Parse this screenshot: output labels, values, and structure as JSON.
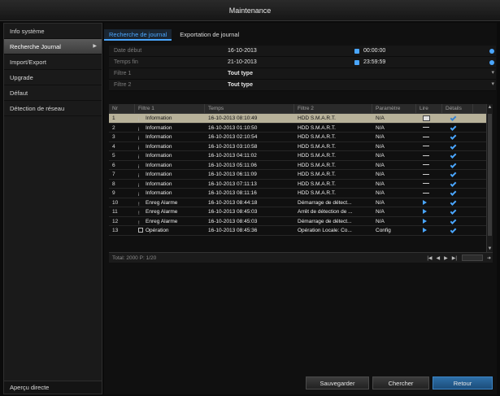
{
  "window": {
    "title": "Maintenance"
  },
  "sidebar": {
    "items": [
      {
        "label": "Info système",
        "active": false
      },
      {
        "label": "Recherche Journal",
        "active": true
      },
      {
        "label": "Import/Export",
        "active": false
      },
      {
        "label": "Upgrade",
        "active": false
      },
      {
        "label": "Défaut",
        "active": false
      },
      {
        "label": "Détection de réseau",
        "active": false
      }
    ],
    "bottom_label": "Aperçu directe"
  },
  "tabs": [
    {
      "label": "Recherche de journal",
      "active": true
    },
    {
      "label": "Exportation de journal",
      "active": false
    }
  ],
  "form": {
    "start_label": "Date début",
    "start_date": "16-10-2013",
    "start_time": "00:00:00",
    "end_label": "Temps fin",
    "end_date": "21-10-2013",
    "end_time": "23:59:59",
    "filter1_label": "Filtre 1",
    "filter1_value": "Tout type",
    "filter2_label": "Filtre 2",
    "filter2_value": "Tout type"
  },
  "table": {
    "headers": [
      "Nr",
      "Filtre 1",
      "Temps",
      "Filtre 2",
      "Paramètre",
      "Lire",
      "Détails"
    ],
    "rows": [
      {
        "nr": "1",
        "type": "Information",
        "icon": "info",
        "time": "16-10-2013 08:10:49",
        "f2": "HDD S.M.A.R.T.",
        "param": "N/A",
        "read": "box",
        "selected": true
      },
      {
        "nr": "2",
        "type": "Information",
        "icon": "info",
        "time": "16-10-2013 01:10:50",
        "f2": "HDD S.M.A.R.T.",
        "param": "N/A",
        "read": "dash",
        "selected": false
      },
      {
        "nr": "3",
        "type": "Information",
        "icon": "info",
        "time": "16-10-2013 02:10:54",
        "f2": "HDD S.M.A.R.T.",
        "param": "N/A",
        "read": "dash",
        "selected": false
      },
      {
        "nr": "4",
        "type": "Information",
        "icon": "info",
        "time": "16-10-2013 03:10:58",
        "f2": "HDD S.M.A.R.T.",
        "param": "N/A",
        "read": "dash",
        "selected": false
      },
      {
        "nr": "5",
        "type": "Information",
        "icon": "info",
        "time": "16-10-2013 04:11:02",
        "f2": "HDD S.M.A.R.T.",
        "param": "N/A",
        "read": "dash",
        "selected": false
      },
      {
        "nr": "6",
        "type": "Information",
        "icon": "info",
        "time": "16-10-2013 05:11:06",
        "f2": "HDD S.M.A.R.T.",
        "param": "N/A",
        "read": "dash",
        "selected": false
      },
      {
        "nr": "7",
        "type": "Information",
        "icon": "info",
        "time": "16-10-2013 06:11:09",
        "f2": "HDD S.M.A.R.T.",
        "param": "N/A",
        "read": "dash",
        "selected": false
      },
      {
        "nr": "8",
        "type": "Information",
        "icon": "info",
        "time": "16-10-2013 07:11:13",
        "f2": "HDD S.M.A.R.T.",
        "param": "N/A",
        "read": "dash",
        "selected": false
      },
      {
        "nr": "9",
        "type": "Information",
        "icon": "info",
        "time": "16-10-2013 08:11:16",
        "f2": "HDD S.M.A.R.T.",
        "param": "N/A",
        "read": "dash",
        "selected": false
      },
      {
        "nr": "10",
        "type": "Enreg Alarme",
        "icon": "alarm",
        "time": "16-10-2013 08:44:18",
        "f2": "Démarrage de détect...",
        "param": "N/A",
        "read": "play",
        "selected": false
      },
      {
        "nr": "11",
        "type": "Enreg Alarme",
        "icon": "alarm",
        "time": "16-10-2013 08:45:03",
        "f2": "Arrêt de détection de ...",
        "param": "N/A",
        "read": "play",
        "selected": false
      },
      {
        "nr": "12",
        "type": "Enreg Alarme",
        "icon": "alarm",
        "time": "16-10-2013 08:45:03",
        "f2": "Démarrage de détect...",
        "param": "N/A",
        "read": "play",
        "selected": false
      },
      {
        "nr": "13",
        "type": "Opération",
        "icon": "op",
        "time": "16-10-2013 08:45:36",
        "f2": "Opération Locale: Co...",
        "param": "Config",
        "read": "play",
        "selected": false
      }
    ]
  },
  "footer": {
    "total": "Total: 2000 P: 1/20"
  },
  "buttons": {
    "save": "Sauvegarder",
    "search": "Chercher",
    "back": "Retour"
  },
  "colors": {
    "accent": "#4aa6ff",
    "selected_row": "#b8b29a"
  }
}
